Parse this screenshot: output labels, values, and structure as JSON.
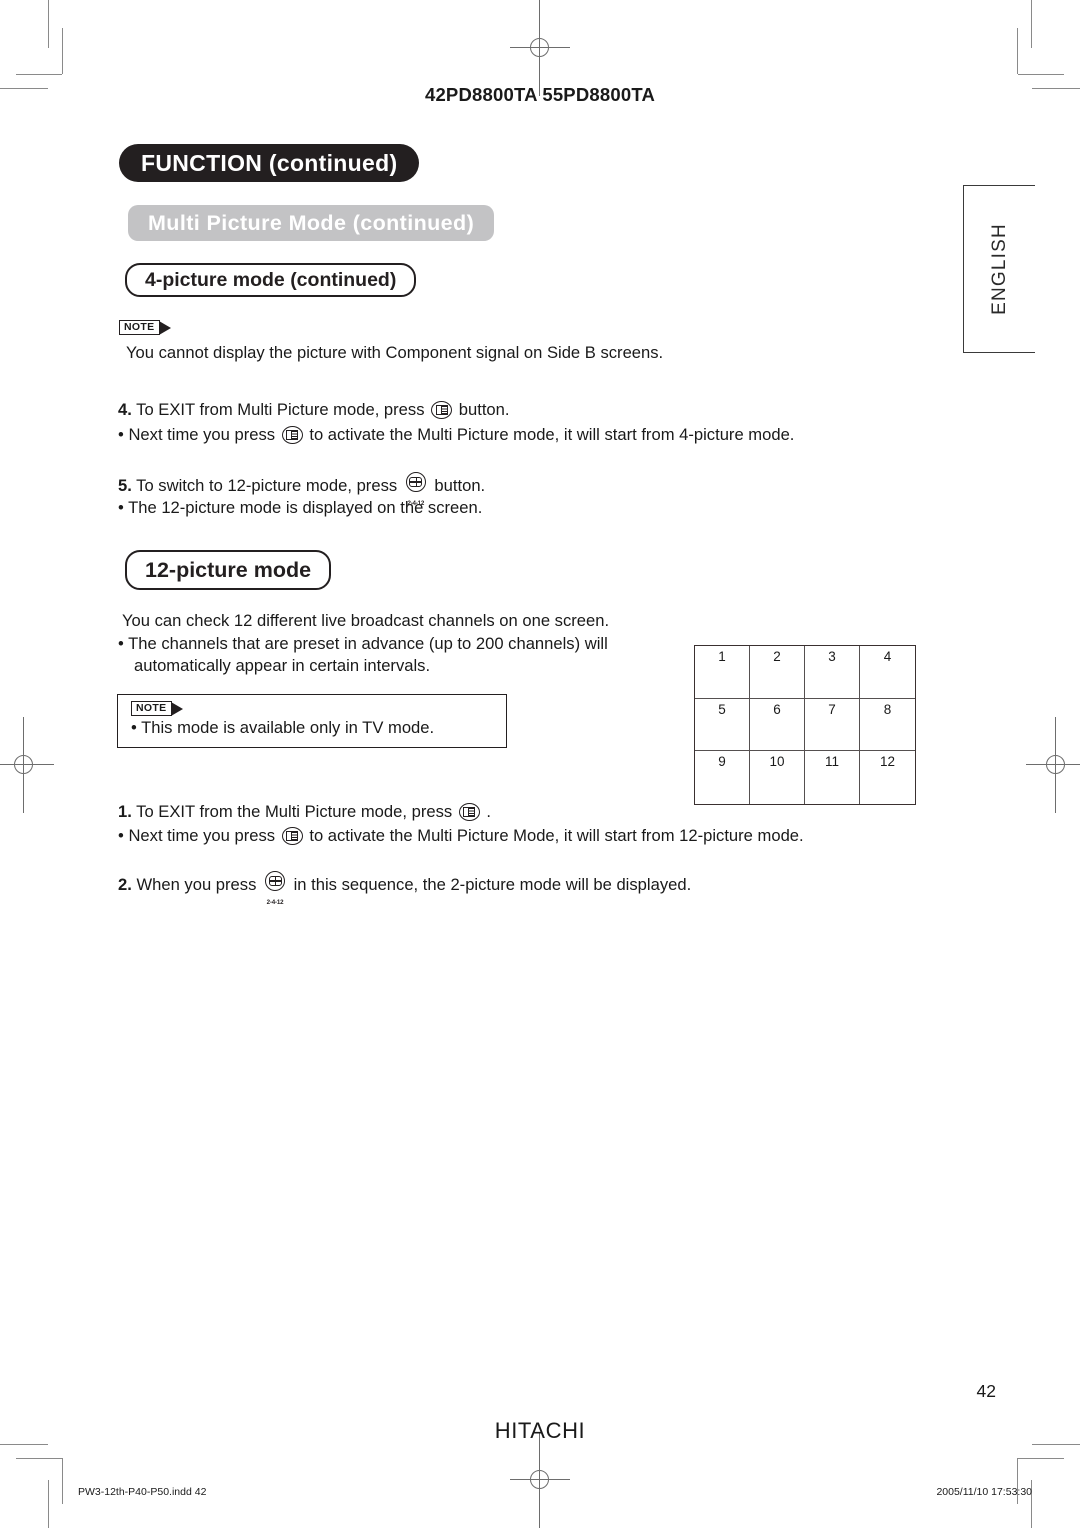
{
  "page": {
    "model_line": "42PD8800TA  55PD8800TA",
    "page_number": "42",
    "brand": "HITACHI",
    "file_stamp": "PW3-12th-P40-P50.indd   42",
    "date_stamp": "2005/11/10   17:53:30",
    "language_tab": "ENGLISH"
  },
  "headings": {
    "chapter": "FUNCTION (continued)",
    "section": "Multi Picture Mode (continued)",
    "subsection_4pic": "4-picture mode (continued)",
    "subsection_12pic": "12-picture mode"
  },
  "note_label": "NOTE",
  "note_top": {
    "text": "You cannot display the picture with Component signal on Side B screens."
  },
  "steps_4pic": [
    {
      "number": "4.",
      "pre": "To EXIT from Multi Picture mode, press",
      "icon": "multi-picture-button-icon",
      "post": "button."
    },
    {
      "number": "•",
      "pre": "Next time you press",
      "icon": "multi-picture-button-icon",
      "post": "to activate the Multi Picture mode, it will start from 4-picture mode."
    },
    {
      "number": "5.",
      "pre": "To switch to 12-picture mode, press",
      "icon": "two-four-twelve-button-icon",
      "post": "button."
    },
    {
      "number": "•",
      "pre": "The 12-picture mode is displayed on the screen.",
      "icon": "",
      "post": ""
    }
  ],
  "body_12pic": {
    "line1": "You can check 12 different live broadcast channels on one screen.",
    "line2": "• The channels that are preset in advance (up to 200 channels) will",
    "line3": "automatically appear in certain intervals."
  },
  "note_box": {
    "text": "• This mode is available only in TV mode."
  },
  "steps_12pic": [
    {
      "number": "1.",
      "pre": "To EXIT from the Multi Picture mode, press",
      "icon": "multi-picture-button-icon",
      "post": "."
    },
    {
      "number": "•",
      "pre": "Next time you press",
      "icon": "multi-picture-button-icon",
      "post": "to activate the Multi Picture Mode, it will start from 12-picture mode."
    },
    {
      "number": "2.",
      "pre": "When you press",
      "icon": "two-four-twelve-button-icon",
      "post": "in this sequence, the 2-picture mode will be displayed."
    }
  ],
  "icon_labels": {
    "two_four_twelve": "2-4-12"
  },
  "grid12": {
    "columns": 4,
    "rows": 3,
    "cells": [
      "1",
      "2",
      "3",
      "4",
      "5",
      "6",
      "7",
      "8",
      "9",
      "10",
      "11",
      "12"
    ]
  },
  "colors": {
    "chapter_banner_bg": "#231f20",
    "section_banner_bg": "#c3c3c5",
    "ink": "#1a1a1a",
    "crop_mark": "#8a8a8a"
  }
}
